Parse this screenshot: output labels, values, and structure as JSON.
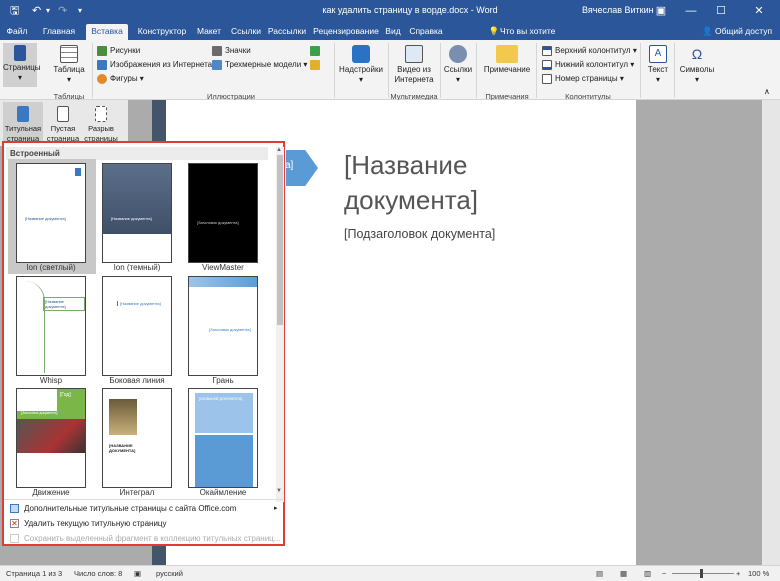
{
  "titlebar": {
    "doc_title": "как удалить страницу в ворде.docx - Word",
    "user": "Вячеслав Виткин",
    "save_icon": "save-icon",
    "undo_icon": "undo-icon",
    "minimize": "—",
    "maximize": "☐",
    "close": "✕",
    "restore_ribbon": "▣"
  },
  "tabs": [
    "Файл",
    "Главная",
    "Вставка",
    "Конструктор",
    "Макет",
    "Ссылки",
    "Рассылки",
    "Рецензирование",
    "Вид",
    "Справка"
  ],
  "tell_me": "Что вы хотите сделать?",
  "share": "Общий доступ",
  "ribbon": {
    "pages": "Страницы",
    "table": "Таблица",
    "tables_group": "Таблицы",
    "pictures": "Рисунки",
    "online_pictures": "Изображения из Интернета",
    "shapes": "Фигуры",
    "icons": "Значки",
    "models3d": "Трехмерные модели",
    "illustrations_group": "Иллюстрации",
    "addins": "Надстройки",
    "online_video_1": "Видео из",
    "online_video_2": "Интернета",
    "media_group": "Мультимедиа",
    "links": "Ссылки",
    "comment": "Примечание",
    "comments_group": "Примечания",
    "header": "Верхний колонтитул",
    "footer": "Нижний колонтитул",
    "page_number": "Номер страницы",
    "hf_group": "Колонтитулы",
    "text": "Текст",
    "symbols": "Символы"
  },
  "subtool": {
    "cover": "Титульная страница",
    "blank": "Пустая страница",
    "break": "Разрыв страницы"
  },
  "document": {
    "title_line1": "[Название",
    "title_line2": "документа]",
    "subtitle": "[Подзаголовок документа]",
    "arrow_text": "а]"
  },
  "gallery": {
    "header": "Встроенный",
    "items": [
      {
        "label": "Ion (светлый)"
      },
      {
        "label": "Ion (темный)"
      },
      {
        "label": "ViewMaster"
      },
      {
        "label": "Whisp"
      },
      {
        "label": "Боковая линия"
      },
      {
        "label": "Грань"
      },
      {
        "label": "Движение"
      },
      {
        "label": "Интеграл"
      },
      {
        "label": "Окаймление"
      }
    ],
    "thumb_text": {
      "ion_light": "[Название документа]",
      "ion_dark": "[Название документа]",
      "viewmaster": "[Заголовок документа]",
      "whisp": "[Название документа]",
      "sideline": "[Название документа]",
      "facet": "[Заголовок документа]",
      "motion_year": "[Год]",
      "motion_title": "[Заголовок документа]",
      "integral": "[НАЗВАНИЕ ДОКУМЕНТА]",
      "border": "[НАЗВАНИЕ ДОКУМЕНТА]"
    },
    "menu": [
      {
        "label": "Дополнительные титульные страницы с сайта Office.com",
        "enabled": true
      },
      {
        "label": "Удалить текущую титульную страницу",
        "enabled": true
      },
      {
        "label": "Сохранить выделенный фрагмент в коллекцию титульных страниц...",
        "enabled": false
      }
    ]
  },
  "status": {
    "page": "Страница 1 из 3",
    "words": "Число слов: 8",
    "lang": "русский",
    "zoom": "100 %"
  },
  "colors": {
    "word_blue": "#2b579a",
    "highlight_red": "#e03a3a",
    "accent_blue": "#5b9bd5"
  }
}
